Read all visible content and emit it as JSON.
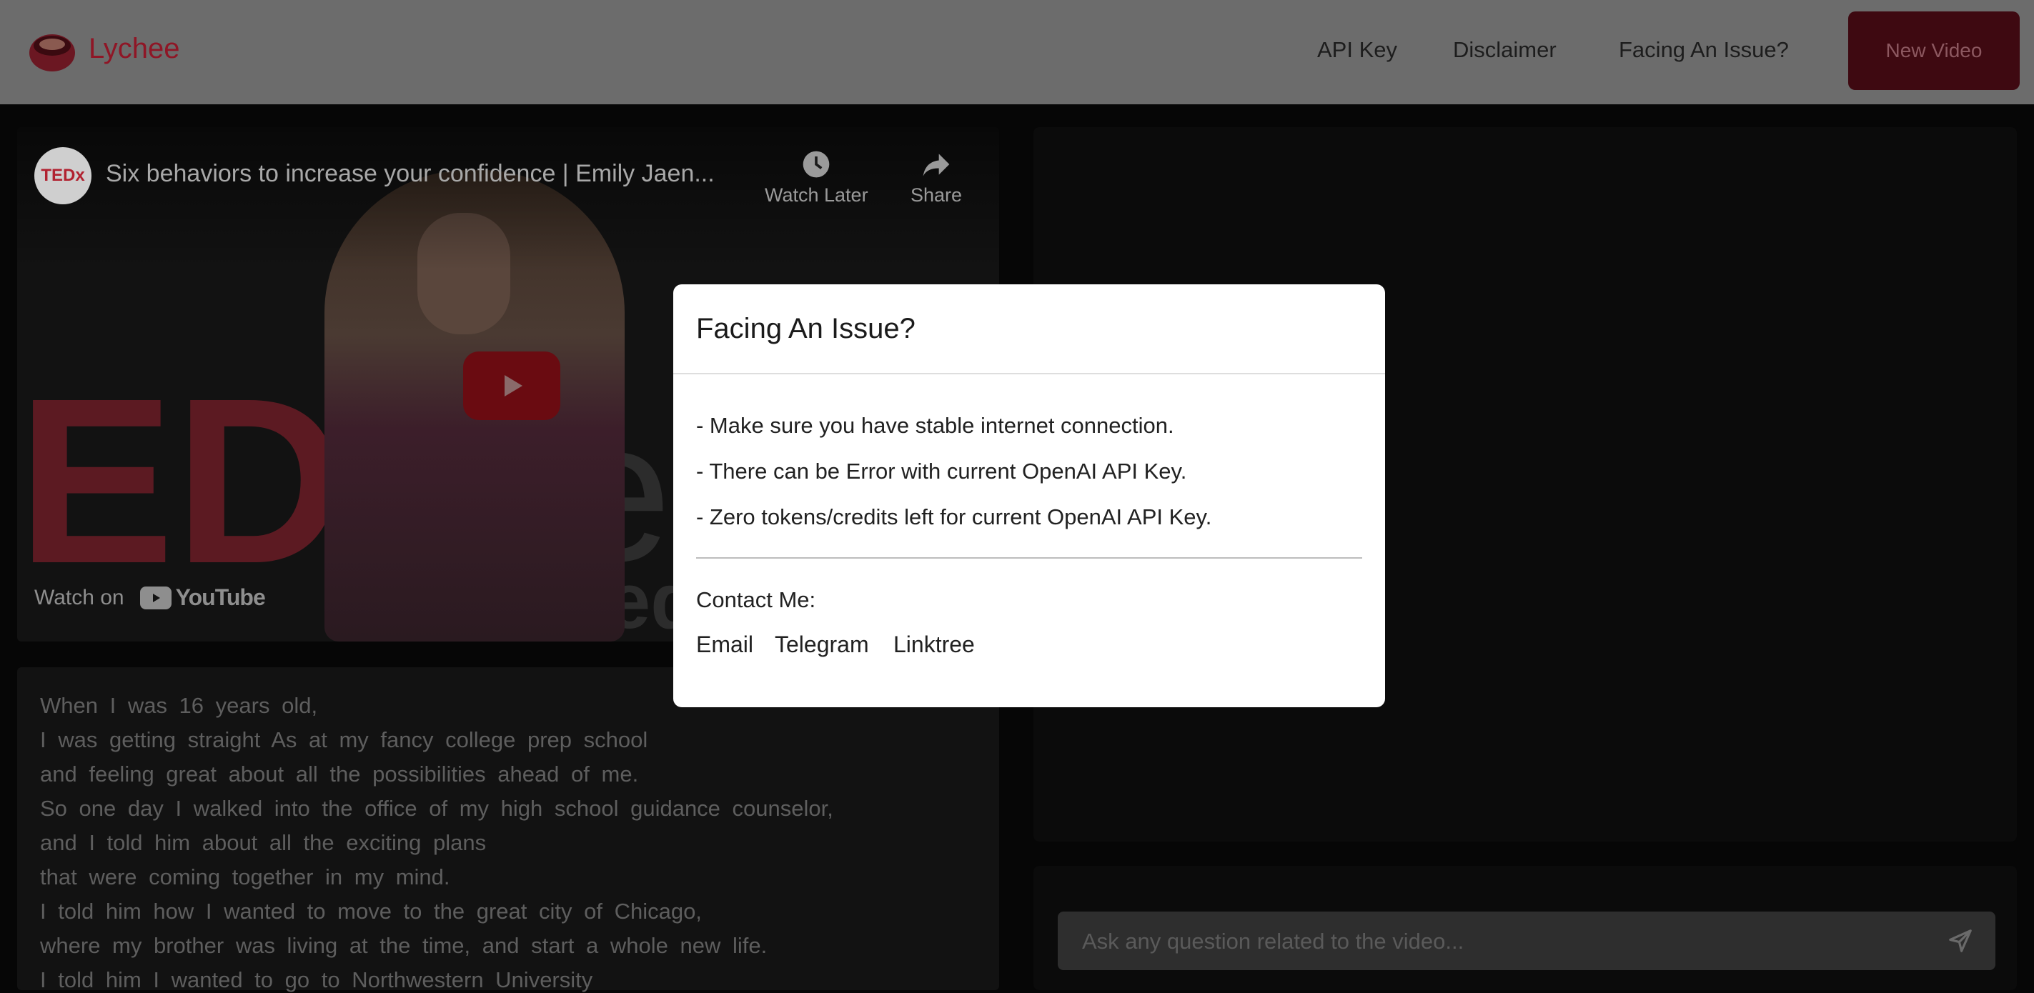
{
  "header": {
    "brand": "Lychee",
    "nav": [
      "API Key",
      "Disclaimer",
      "Facing An Issue?"
    ],
    "new_video": "New Video"
  },
  "video": {
    "channel_badge": "TEDx",
    "title": "Six behaviors to increase your confidence | Emily Jaen...",
    "watch_later": "Watch Later",
    "share": "Share",
    "watch_on": "Watch on",
    "youtube": "YouTube"
  },
  "transcript": [
    "When I was 16 years old,",
    "I was getting straight As at my fancy college prep school",
    "and feeling great about all the possibilities ahead of me.",
    "So one day I walked into the office of my high school guidance counselor,",
    "and I told him about all the exciting plans",
    "that were coming together in my mind.",
    "I told him how I wanted to move to the great city of Chicago,",
    "where my brother was living at the time, and start a whole new life.",
    "I told him I wanted to go to Northwestern University"
  ],
  "chat": {
    "placeholder": "Ask any question related to the video..."
  },
  "modal": {
    "title": "Facing An Issue?",
    "items": [
      "- Make sure you have stable internet connection.",
      "- There can be Error with current OpenAI API Key.",
      "- Zero tokens/credits left for current OpenAI API Key."
    ],
    "contact_label": "Contact Me:",
    "links": [
      "Email",
      "Telegram",
      "Linktree"
    ]
  },
  "colors": {
    "brand": "#8f1626",
    "primary_button": "#3e0911",
    "modal_bg": "#ffffff"
  }
}
